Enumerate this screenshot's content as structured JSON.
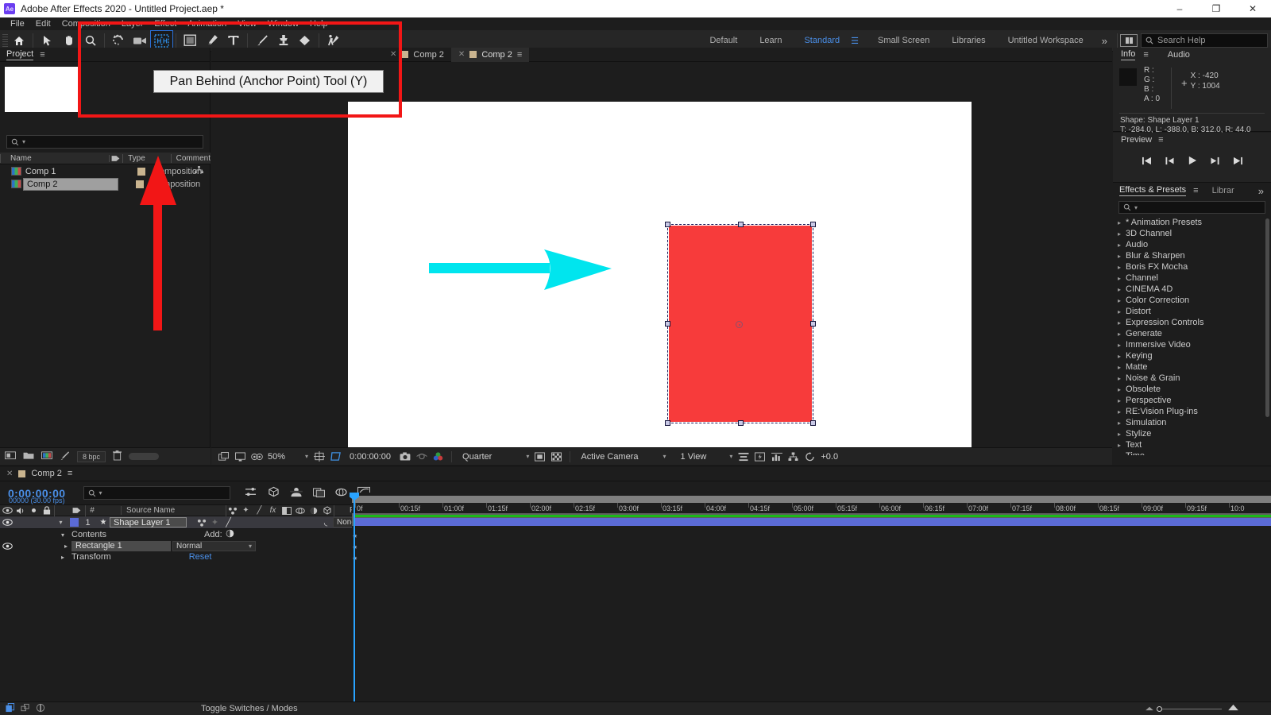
{
  "window": {
    "title": "Adobe After Effects 2020 - Untitled Project.aep *",
    "logo": "Ae",
    "minimize": "–",
    "maximize": "❐",
    "close": "✕"
  },
  "menu": {
    "items": [
      "File",
      "Edit",
      "Composition",
      "Layer",
      "Effect",
      "Animation",
      "View",
      "Window",
      "Help"
    ]
  },
  "toolbar": {
    "left_icons": [
      "home-icon",
      "selection-tool-icon",
      "hand-tool-icon",
      "zoom-tool-icon"
    ],
    "tools": [
      {
        "name": "rotation-tool",
        "glyph": "↺"
      },
      {
        "name": "camera-tool",
        "glyph": "▭"
      },
      {
        "name": "pan-behind-tool",
        "glyph": "⬚"
      },
      {
        "name": "shape-tool",
        "glyph": "■"
      },
      {
        "name": "pen-tool",
        "glyph": "✒"
      },
      {
        "name": "type-tool",
        "glyph": "T"
      },
      {
        "name": "brush-tool",
        "glyph": "✐"
      },
      {
        "name": "clone-stamp-tool",
        "glyph": "⚓"
      },
      {
        "name": "eraser-tool",
        "glyph": "◆"
      },
      {
        "name": "roto-brush-tool",
        "glyph": "Ὣ6"
      }
    ],
    "workspaces": [
      "Default",
      "Learn",
      "Standard",
      "Small Screen",
      "Libraries",
      "Untitled Workspace"
    ],
    "active_workspace": "Standard",
    "overflow": "»",
    "search_help_placeholder": "Search Help"
  },
  "annotation": {
    "tooltip": "Pan Behind (Anchor Point) Tool (Y)",
    "highlight_color": "#f21616",
    "arrow_color": "#00e5ee"
  },
  "project": {
    "tabs": [
      {
        "label": "Project",
        "active": true
      }
    ],
    "menu_icon": "≡",
    "search_placeholder": "",
    "columns": [
      "Name",
      "Type",
      "Comment"
    ],
    "rows": [
      {
        "name": "Comp 1",
        "type": "Composition",
        "selected": false
      },
      {
        "name": "Comp 2",
        "type": "Composition",
        "selected": true
      }
    ],
    "footer": {
      "bit_depth": "8 bpc"
    }
  },
  "composition": {
    "tabs": [
      {
        "label": "Comp 2",
        "active": false
      },
      {
        "label": "Comp 2",
        "active": true
      }
    ],
    "dropdown_caret": "▾",
    "zoom": "50%",
    "time": "0:00:00:00",
    "resolution": "Quarter",
    "camera": "Active Camera",
    "views": "1 View",
    "exposure": "+0.0",
    "shape_color": "#f73b3b"
  },
  "info": {
    "tabs": [
      "Info",
      "Audio"
    ],
    "menu_icon": "≡",
    "channels": [
      "R :",
      "G :",
      "B :",
      "A : 0"
    ],
    "x": "X : -420",
    "y": "Y : 1004",
    "shape_line": "Shape: Shape Layer 1",
    "bounds_line": "T: -284.0, L: -388.0, B: 312.0, R: 44.0"
  },
  "preview": {
    "title": "Preview",
    "menu_icon": "≡",
    "buttons": [
      "first-frame",
      "previous-frame",
      "play",
      "next-frame",
      "last-frame"
    ]
  },
  "effects": {
    "tabs": [
      {
        "label": "Effects & Presets",
        "active": true
      },
      {
        "label": "Librar",
        "active": false
      }
    ],
    "menu_icon": "≡",
    "overflow": "»",
    "search_placeholder": "",
    "categories": [
      "* Animation Presets",
      "3D Channel",
      "Audio",
      "Blur & Sharpen",
      "Boris FX Mocha",
      "Channel",
      "CINEMA 4D",
      "Color Correction",
      "Distort",
      "Expression Controls",
      "Generate",
      "Immersive Video",
      "Keying",
      "Matte",
      "Noise & Grain",
      "Obsolete",
      "Perspective",
      "RE:Vision Plug-ins",
      "Simulation",
      "Stylize",
      "Text",
      "Time"
    ]
  },
  "timeline": {
    "tab_label": "Comp 2",
    "menu_icon": "≡",
    "current_time": "0:00:00:00",
    "frame_info": "00000 (30.00 fps)",
    "search_placeholder": "",
    "columns": [
      "Source Name",
      "Parent & Link"
    ],
    "layers": [
      {
        "index": "1",
        "name": "Shape Layer 1",
        "parent": "None",
        "selected": true,
        "children": [
          {
            "label": "Contents",
            "add_label": "Add:"
          },
          {
            "label": "Rectangle 1",
            "mode": "Normal"
          },
          {
            "label": "Transform",
            "reset": "Reset"
          }
        ]
      }
    ],
    "ruler_ticks": [
      "0f",
      "00:15f",
      "01:00f",
      "01:15f",
      "02:00f",
      "02:15f",
      "03:00f",
      "03:15f",
      "04:00f",
      "04:15f",
      "05:00f",
      "05:15f",
      "06:00f",
      "06:15f",
      "07:00f",
      "07:15f",
      "08:00f",
      "08:15f",
      "09:00f",
      "09:15f",
      "10:0"
    ],
    "footer_label": "Toggle Switches / Modes"
  }
}
